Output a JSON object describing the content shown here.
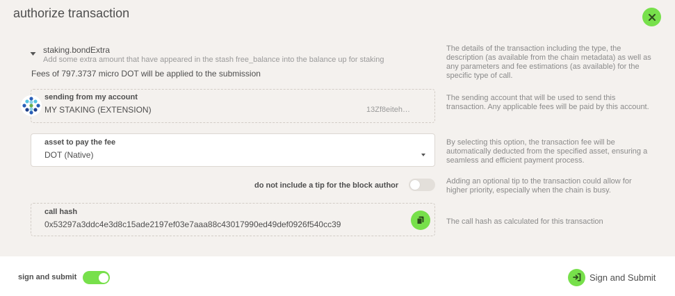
{
  "modal": {
    "title": "authorize transaction"
  },
  "call": {
    "method": "staking.bondExtra",
    "description": "Add some extra amount that have appeared in the stash free_balance into the balance up for staking",
    "fees": "Fees of 797.3737 micro DOT will be applied to the submission",
    "help": "The details of the transaction including the type, the description (as available from the chain metadata) as well as any parameters and fee estimations (as available) for the specific type of call."
  },
  "account": {
    "label": "sending from my account",
    "name": "MY STAKING (EXTENSION)",
    "address_short": "13Zf8eiteh…",
    "help": "The sending account that will be used to send this transaction. Any applicable fees will be paid by this account."
  },
  "fee_asset": {
    "label": "asset to pay the fee",
    "value": "DOT (Native)",
    "help": "By selecting this option, the transaction fee will be automatically deducted from the specified asset, ensuring a seamless and efficient payment process."
  },
  "tip": {
    "label": "do not include a tip for the block author",
    "enabled": false,
    "help": "Adding an optional tip to the transaction could allow for higher priority, especially when the chain is busy."
  },
  "call_hash": {
    "label": "call hash",
    "value": "0x53297a3ddc4e3d8c15ade2197ef03e7aaa88c43017990ed49def0926f540cc39",
    "help": "The call hash as calculated for this transaction"
  },
  "footer": {
    "sign_label": "sign and submit",
    "sign_enabled": true,
    "submit_label": "Sign and Submit"
  },
  "colors": {
    "accent": "#77e04b",
    "background": "#f4f1ee",
    "text": "#4e4e4e",
    "muted": "#8a8a8a"
  },
  "icons": {
    "close": "close-icon",
    "collapse": "caret-down-icon",
    "identity": "identicon",
    "dropdown": "chevron-down-icon",
    "copy": "copy-icon",
    "submit": "sign-in-icon"
  }
}
